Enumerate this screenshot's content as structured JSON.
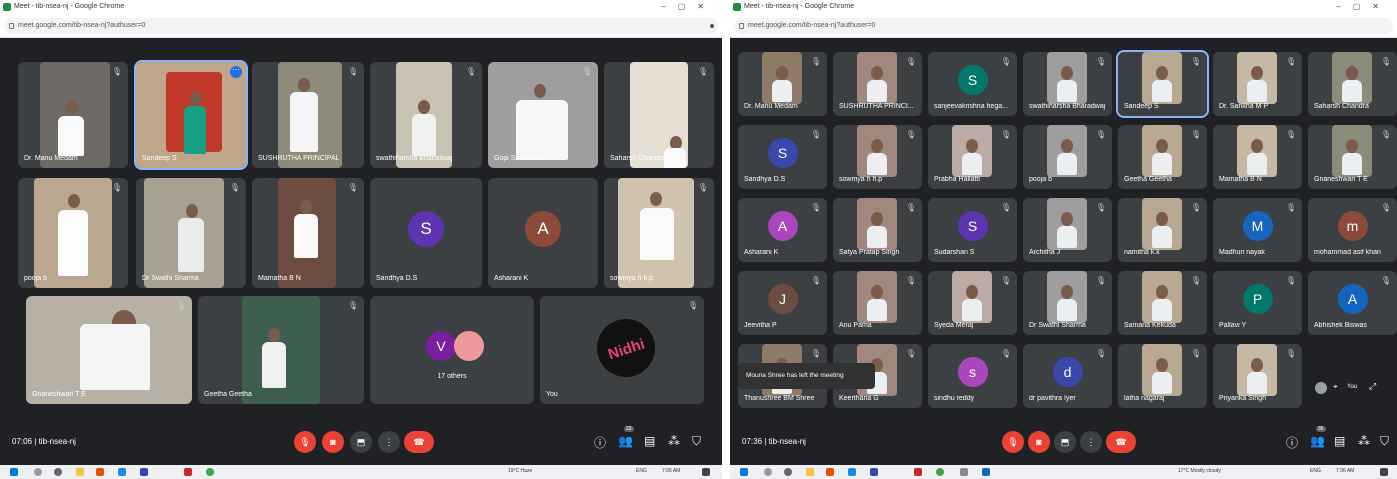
{
  "left": {
    "window_title": "Meet - tib-nsea-nj - Google Chrome",
    "url": "meet.google.com/tib-nsea-nj?authuser=0",
    "clock": "07:06",
    "meeting_code": "tib-nsea-nj",
    "participants_badge": "22",
    "others_label": "17 others",
    "tiles": [
      {
        "name": "Dr. Manu Medam"
      },
      {
        "name": "Sandeep S"
      },
      {
        "name": "SUSHRUTHA PRINCIPAL"
      },
      {
        "name": "swathiharsha Bharadwaj"
      },
      {
        "name": "Gopi Sankha M P"
      },
      {
        "name": "Saharsh Chandra"
      },
      {
        "name": "pooja b"
      },
      {
        "name": "Dr Swathi Sharma"
      },
      {
        "name": "Mamatha B N"
      },
      {
        "name": "Sandhya D.S",
        "initial": "S"
      },
      {
        "name": "Asharani K",
        "initial": "A"
      },
      {
        "name": "sowmya h h.p"
      },
      {
        "name": "Gnaneshwari T E"
      },
      {
        "name": "Geetha Geetha"
      },
      {
        "name": "",
        "initial": "V"
      },
      {
        "name": "You",
        "art_text": "Nidhi"
      }
    ],
    "taskbar_weather": "19°C Haze",
    "taskbar_time": "7:06 AM",
    "taskbar_lang": "ENG"
  },
  "right": {
    "window_title": "Meet - tib-nsea-nj - Google Chrome",
    "url": "meet.google.com/tib-nsea-nj?authuser=0",
    "clock": "07:36",
    "meeting_code": "tib-nsea-nj",
    "participants_badge": "36",
    "toast": "Mouna Shree has left the meeting",
    "you_label": "You",
    "tiles": [
      {
        "name": "Dr. Manu Medam"
      },
      {
        "name": "SUSHRUTHA PRINCI..."
      },
      {
        "name": "sanjeevakrishna hega...",
        "initial": "S"
      },
      {
        "name": "swathiharsha Bharadwaj"
      },
      {
        "name": "Sandeep S"
      },
      {
        "name": "Dr. Sankha M P"
      },
      {
        "name": "Saharsh Chandra"
      },
      {
        "name": "Sandhya D.S",
        "initial": "S"
      },
      {
        "name": "sowmya h h.p"
      },
      {
        "name": "Prabha Hallatti"
      },
      {
        "name": "pooja b"
      },
      {
        "name": "Geetha Geetha"
      },
      {
        "name": "Mamatha B N"
      },
      {
        "name": "Gnaneshwari T E"
      },
      {
        "name": "Asharani K",
        "initial": "A"
      },
      {
        "name": "Satya Pratap Singh"
      },
      {
        "name": "Sudarshan S",
        "initial": "S"
      },
      {
        "name": "Architha J"
      },
      {
        "name": "namitha k.k"
      },
      {
        "name": "Madhuri nayak",
        "initial": "M"
      },
      {
        "name": "mohammad asif khan",
        "initial": "m"
      },
      {
        "name": "Jeevitha P",
        "initial": "J"
      },
      {
        "name": "Anu Pama"
      },
      {
        "name": "Syeda Meraj"
      },
      {
        "name": "Dr Swathi Sharma"
      },
      {
        "name": "Samana Kekuda"
      },
      {
        "name": "Pallavi Y",
        "initial": "P"
      },
      {
        "name": "Abhishek Biswas",
        "initial": "A"
      },
      {
        "name": "Thanushree BM Shree"
      },
      {
        "name": "Keerthana G"
      },
      {
        "name": "sindhu reddy",
        "initial": "s"
      },
      {
        "name": "dr pavithra Iyer",
        "initial": "d"
      },
      {
        "name": "latha nagaraj"
      },
      {
        "name": "Priyanka Singh"
      }
    ],
    "taskbar_weather": "17°C Mostly cloudy",
    "taskbar_time": "7:36 AM",
    "taskbar_lang": "ENG"
  },
  "colors": {
    "meet_bg": "#202124",
    "tile_bg": "#3c4043",
    "end_call": "#ea4335",
    "accent": "#1a73e8"
  },
  "icons": {
    "mic": "mic-off-icon",
    "camera": "camera-off-icon",
    "present": "present-icon",
    "more": "more-vert-icon",
    "end": "end-call-icon",
    "info": "info-icon",
    "people": "people-icon",
    "chat": "chat-icon",
    "activities": "activities-icon",
    "host": "shield-icon"
  }
}
